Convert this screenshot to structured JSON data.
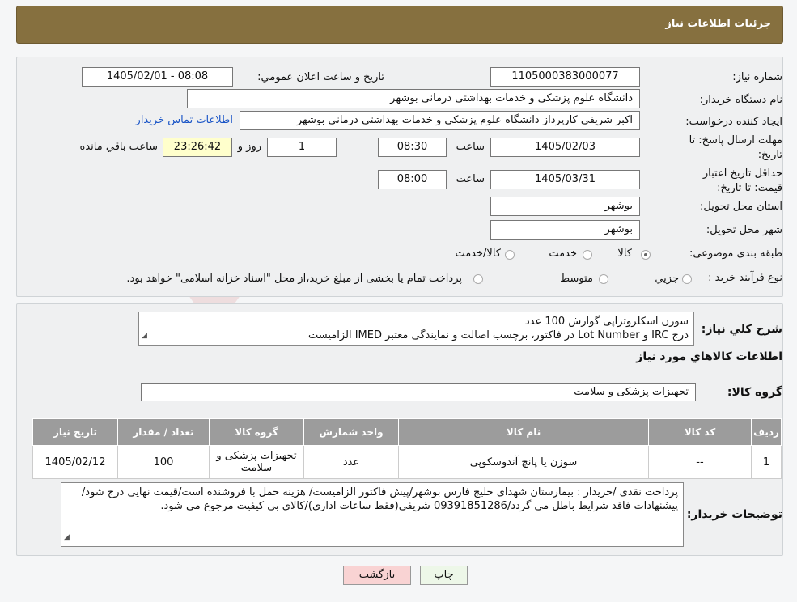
{
  "header": {
    "title": "جزئیات اطلاعات نیاز"
  },
  "form": {
    "need_number_label": "شماره نیاز:",
    "need_number": "1105000383000077",
    "announce_label": "تاریخ و ساعت اعلان عمومي:",
    "announce_value": "1405/02/01 - 08:08",
    "buyer_org_label": "نام دستگاه خريدار:",
    "buyer_org": "دانشگاه علوم پزشکی و خدمات بهداشتی درمانی بوشهر",
    "requester_label": "ايجاد کننده درخواست:",
    "requester": "اکبر شریفی کارپرداز دانشگاه علوم پزشکی و خدمات بهداشتی درمانی بوشهر",
    "contact_link": "اطلاعات تماس خريدار",
    "deadline_label": "مهلت ارسال پاسخ: تا تاريخ:",
    "deadline_date": "1405/02/03",
    "time_label": "ساعت",
    "deadline_time": "08:30",
    "days_value": "1",
    "days_label": "روز و",
    "remaining_value": "23:26:42",
    "remaining_label": "ساعت باقي مانده",
    "validity_label": "حداقل تاريخ اعتبار قيمت: تا تاريخ:",
    "validity_date": "1405/03/31",
    "validity_time": "08:00",
    "province_label": "استان محل تحويل:",
    "province": "بوشهر",
    "city_label": "شهر محل تحويل:",
    "city": "بوشهر",
    "category_label": "طبقه بندی موضوعی:",
    "category_options": [
      "کالا",
      "خدمت",
      "کالا/خدمت"
    ],
    "process_label": "نوع فرآيند خريد :",
    "process_options": [
      "جزيي",
      "متوسط"
    ],
    "process_note": "پرداخت تمام يا بخشی از مبلغ خريد،از محل \"اسناد خزانه اسلامی\" خواهد بود."
  },
  "summary": {
    "label": "شرح كلي نياز:",
    "line1": "سوزن اسکلروتراپی گوارش 100 عدد",
    "line2": "درج IRC و Lot Number در فاکتور، برچسب اصالت و نمایندگی معتبر IMED الزامیست"
  },
  "goods": {
    "section_title": "اطلاعات كالاهاي مورد نياز",
    "group_label": "گروه كالا:",
    "group_value": "تجهیزات پزشکی و سلامت",
    "columns": [
      "رديف",
      "كد كالا",
      "نام كالا",
      "واحد شمارش",
      "گروه كالا",
      "تعداد / مقدار",
      "تاريخ نياز"
    ],
    "rows": [
      [
        "1",
        "--",
        "سوزن یا پانچ آندوسکوپی",
        "عدد",
        "تجهیزات پزشکی و سلامت",
        "100",
        "1405/02/12"
      ]
    ]
  },
  "buyer_notes": {
    "label": "توضيحات خريدار:",
    "text": "پرداخت نقدی /خریدار : بیمارستان شهدای خلیج فارس بوشهر/پیش فاکتور الزامیست/ هزینه حمل با فروشنده است/قیمت نهایی درج شود/پیشنهادات فاقد شرایط باطل می گردد/09391851286 شریفی(فقط ساعات اداری)/کالای بی کیفیت مرجوع می شود."
  },
  "buttons": {
    "print": "چاپ",
    "back": "بازگشت"
  },
  "colors": {
    "header_bg": "#86703f",
    "link": "#1a55c7",
    "back_button_bg": "#f9d3d3",
    "print_button_bg": "#edf7e8"
  }
}
